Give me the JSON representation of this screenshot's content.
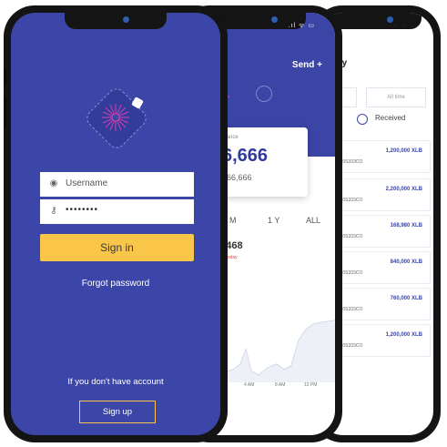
{
  "login": {
    "username_placeholder": "Username",
    "password_value": "••••••••",
    "signin_label": "Sign in",
    "forgot_label": "Forgot password",
    "no_account_text": "If you don't have account",
    "signup_label": "Sign up"
  },
  "wallet": {
    "title": "me",
    "send_label": "Send +",
    "card_label": "alance",
    "card_big": "6,666",
    "card_small": "666,666",
    "periods": [
      "M",
      "1 Y",
      "ALL"
    ],
    "price": "29468",
    "change": ".01%) today",
    "times": [
      "AM",
      "4 AM",
      "8 AM",
      "12 PM"
    ]
  },
  "history": {
    "title": "istory",
    "filter_week": "Week",
    "filter_all": "All time",
    "radio_sent": "ent",
    "radio_received": "Received",
    "transactions": [
      {
        "amount": "1,200,000 XLB",
        "address": "...DC3NC0S333CO"
      },
      {
        "amount": "2,200,000 XLB",
        "address": "...DC3NC0S333CO"
      },
      {
        "amount": "168,980 XLB",
        "address": "...DC3NC0S333CO"
      },
      {
        "amount": "840,000 XLB",
        "address": "...DC3NC0S333CO"
      },
      {
        "amount": "760,000 XLB",
        "address": "...DC3NC0S333CO"
      },
      {
        "amount": "1,200,000 XLB",
        "address": "...DC3NC0S333CO"
      }
    ]
  },
  "colors": {
    "primary": "#3c46a8",
    "accent": "#f9c64a",
    "negative": "#e04444"
  },
  "icons": {
    "user": "user-icon",
    "key": "key-icon",
    "logo": "flower-logo-icon"
  }
}
